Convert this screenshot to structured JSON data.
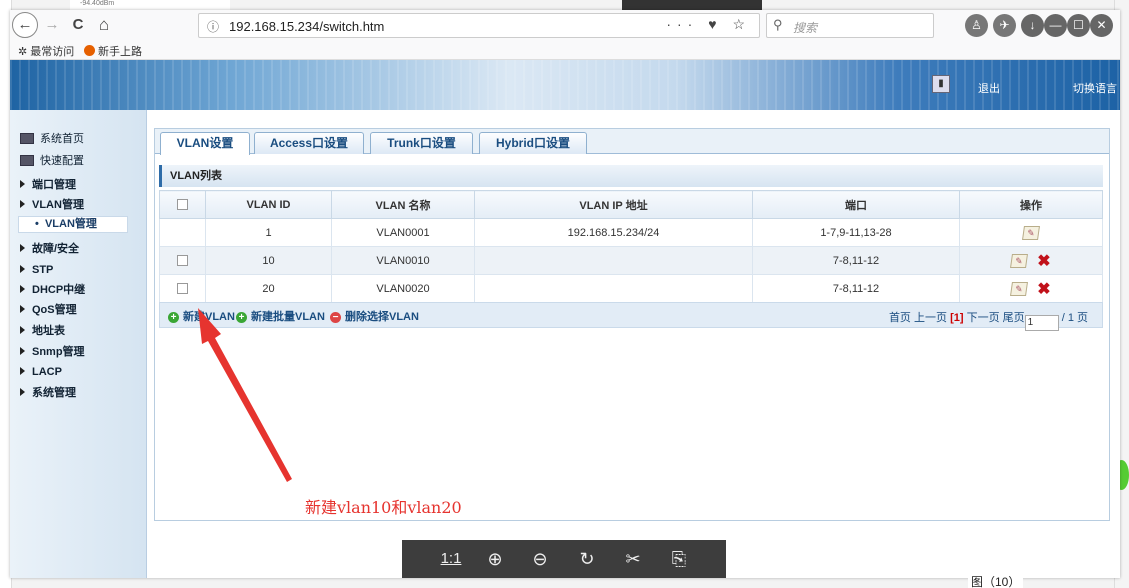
{
  "background": {
    "top_label": "-94.40dBm",
    "figure_caption": "图（10）"
  },
  "browser": {
    "back_icon": "←",
    "forward_icon": "→",
    "reload_icon": "C",
    "home_icon": "⌂",
    "url_info_icon": "ⓘ",
    "url": "192.168.15.234/switch.htm",
    "url_actions": "··· ♥ ☆",
    "search_placeholder": "搜索",
    "bookmarks": [
      {
        "label": "最常访问"
      },
      {
        "label": "新手上路"
      }
    ]
  },
  "header": {
    "logout": "退出",
    "language": "切换语言"
  },
  "sidebar": {
    "items": [
      {
        "label": "系统首页"
      },
      {
        "label": "快速配置"
      },
      {
        "label": "端口管理"
      },
      {
        "label": "VLAN管理"
      },
      {
        "label": "VLAN管理"
      },
      {
        "label": "故障/安全"
      },
      {
        "label": "STP"
      },
      {
        "label": "DHCP中继"
      },
      {
        "label": "QoS管理"
      },
      {
        "label": "地址表"
      },
      {
        "label": "Snmp管理"
      },
      {
        "label": "LACP"
      },
      {
        "label": "系统管理"
      }
    ]
  },
  "tabs": [
    {
      "label": "VLAN设置"
    },
    {
      "label": "Access口设置"
    },
    {
      "label": "Trunk口设置"
    },
    {
      "label": "Hybrid口设置"
    }
  ],
  "panel": {
    "title": "VLAN列表"
  },
  "table": {
    "headers": [
      "VLAN ID",
      "VLAN 名称",
      "VLAN IP 地址",
      "端口",
      "操作"
    ],
    "rows": [
      {
        "id": "1",
        "name": "VLAN0001",
        "ip": "192.168.15.234/24",
        "ports": "1-7,9-11,13-28"
      },
      {
        "id": "10",
        "name": "VLAN0010",
        "ip": "",
        "ports": "7-8,11-12"
      },
      {
        "id": "20",
        "name": "VLAN0020",
        "ip": "",
        "ports": "7-8,11-12"
      }
    ]
  },
  "footer": {
    "new_vlan": "新建VLAN",
    "new_batch": "新建批量VLAN",
    "delete_selected": "删除选择VLAN",
    "first": "首页",
    "prev": "上一页",
    "current": "[1]",
    "next": "下一页",
    "last": "尾页",
    "page_value": "1",
    "total": "/ 1 页"
  },
  "annotation": {
    "text": "新建vlan10和vlan20",
    "color": "#e6342f"
  },
  "viewer": {
    "actual_size": "1:1"
  }
}
